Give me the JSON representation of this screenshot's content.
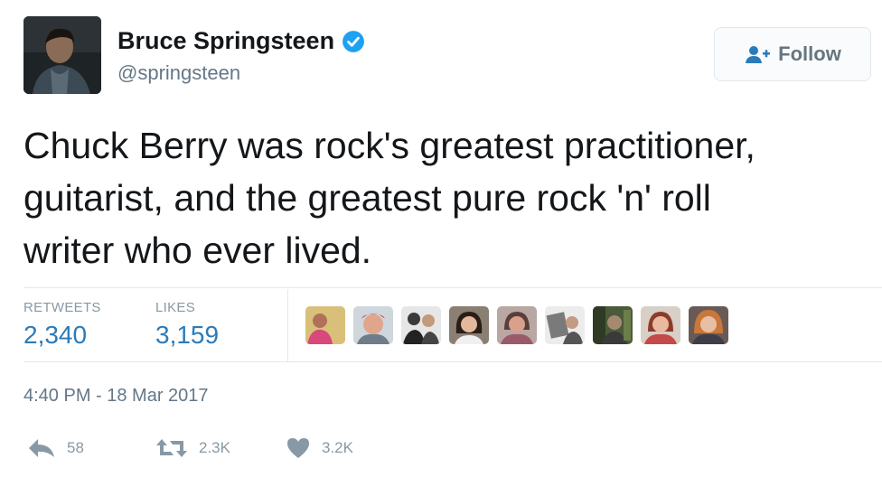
{
  "profile": {
    "name": "Bruce Springsteen",
    "handle": "@springsteen",
    "avatar_icon": "profile-photo",
    "verified_icon": "verified-badge-icon",
    "verified_color": "#1da1f2"
  },
  "follow_button": {
    "label": "Follow",
    "icon": "add-user-icon"
  },
  "tweet": {
    "lines": [
      "Chuck Berry was rock's greatest practitioner,",
      "guitarist, and the greatest pure rock 'n' roll",
      "writer who ever lived."
    ]
  },
  "stats": {
    "retweets_label": "RETWEETS",
    "retweets_value": "2,340",
    "likes_label": "LIKES",
    "likes_value": "3,159",
    "link_color": "#2b7bb9"
  },
  "likers": [
    {
      "icon": "liker-avatar-1"
    },
    {
      "icon": "liker-avatar-2"
    },
    {
      "icon": "liker-avatar-3"
    },
    {
      "icon": "liker-avatar-4"
    },
    {
      "icon": "liker-avatar-5"
    },
    {
      "icon": "liker-avatar-6"
    },
    {
      "icon": "liker-avatar-7"
    },
    {
      "icon": "liker-avatar-8"
    },
    {
      "icon": "liker-avatar-9"
    }
  ],
  "timestamp": "4:40 PM - 18 Mar 2017",
  "actions": {
    "reply": {
      "icon": "reply-icon",
      "count": "58"
    },
    "retweet": {
      "icon": "retweet-icon",
      "count": "2.3K"
    },
    "like": {
      "icon": "heart-icon",
      "count": "3.2K"
    }
  }
}
